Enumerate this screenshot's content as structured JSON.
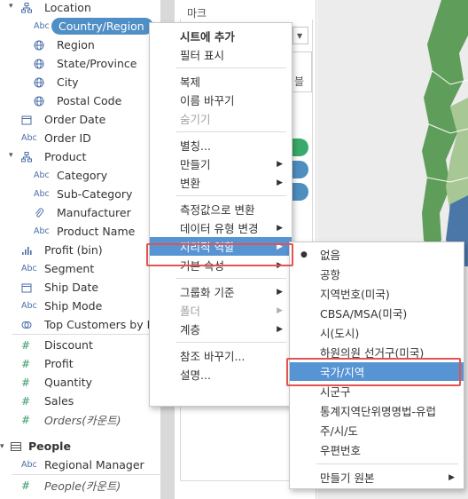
{
  "data_pane": {
    "fields": [
      {
        "icon": "hierarchy-icon",
        "label": "Location",
        "caret": true
      },
      {
        "icon": "abc-icon",
        "icon_text": "Abc",
        "label": "Country/Region",
        "selected": true
      },
      {
        "icon": "globe-icon",
        "label": "Region"
      },
      {
        "icon": "globe-icon",
        "label": "State/Province"
      },
      {
        "icon": "globe-icon",
        "label": "City"
      },
      {
        "icon": "globe-icon",
        "label": "Postal Code"
      },
      {
        "icon": "calendar-icon",
        "label": "Order Date"
      },
      {
        "icon": "abc-icon",
        "icon_text": "Abc",
        "label": "Order ID"
      },
      {
        "icon": "hierarchy-icon",
        "label": "Product",
        "caret": true
      },
      {
        "icon": "abc-icon",
        "icon_text": "Abc",
        "label": "Category"
      },
      {
        "icon": "abc-icon",
        "icon_text": "Abc",
        "label": "Sub-Category"
      },
      {
        "icon": "paperclip-icon",
        "label": "Manufacturer"
      },
      {
        "icon": "abc-icon",
        "icon_text": "Abc",
        "label": "Product Name"
      },
      {
        "icon": "bin-icon",
        "label": "Profit (bin)"
      },
      {
        "icon": "abc-icon",
        "icon_text": "Abc",
        "label": "Segment"
      },
      {
        "icon": "calendar-icon",
        "label": "Ship Date"
      },
      {
        "icon": "abc-icon",
        "icon_text": "Abc",
        "label": "Ship Mode"
      },
      {
        "icon": "set-icon",
        "label": "Top Customers by P..."
      }
    ],
    "measures": [
      {
        "icon": "hash-icon",
        "icon_text": "#",
        "label": "Discount"
      },
      {
        "icon": "hash-icon",
        "icon_text": "#",
        "label": "Profit"
      },
      {
        "icon": "hash-icon",
        "icon_text": "#",
        "label": "Quantity"
      },
      {
        "icon": "hash-icon",
        "icon_text": "#",
        "label": "Sales"
      },
      {
        "icon": "hash-icon",
        "icon_text": "#",
        "label": "Orders(카운트)",
        "italic": true
      }
    ],
    "people": {
      "title": "People",
      "fields": [
        {
          "icon": "abc-icon",
          "icon_text": "Abc",
          "label": "Regional Manager"
        },
        {
          "icon": "hash-icon",
          "icon_text": "#",
          "label": "People(카운트)",
          "italic": true
        }
      ]
    }
  },
  "marks": {
    "title": "마크",
    "label_fragment": "블",
    "pill_colors": [
      "#3aaa6a",
      "#4e8fbf",
      "#4e8fbf"
    ]
  },
  "map": {
    "colors": {
      "land": "#5f9e5a",
      "land_light": "#9dc08c",
      "water": "#e8e8e8",
      "blue": "#4b77a8"
    }
  },
  "context_menu": {
    "items": [
      {
        "label": "시트에 추가",
        "bold": true
      },
      {
        "label": "필터 표시"
      },
      {
        "sep": true
      },
      {
        "label": "복제"
      },
      {
        "label": "이름 바꾸기"
      },
      {
        "label": "숨기기",
        "disabled": true
      },
      {
        "sep": true
      },
      {
        "label": "별칭..."
      },
      {
        "label": "만들기",
        "submenu": true
      },
      {
        "label": "변환",
        "submenu": true
      },
      {
        "sep": true
      },
      {
        "label": "측정값으로 변환"
      },
      {
        "label": "데이터 유형 변경",
        "submenu": true
      },
      {
        "label": "지리적 역할",
        "submenu": true,
        "highlighted": true
      },
      {
        "label": "기본 속성",
        "submenu": true
      },
      {
        "sep": true
      },
      {
        "label": "그룹화 기준",
        "submenu": true
      },
      {
        "label": "폴더",
        "submenu": true,
        "disabled": true
      },
      {
        "label": "계층",
        "submenu": true
      },
      {
        "sep": true
      },
      {
        "label": "참조 바꾸기..."
      },
      {
        "label": "설명..."
      }
    ]
  },
  "geo_submenu": {
    "items": [
      {
        "label": "없음",
        "checked": true
      },
      {
        "label": "공항"
      },
      {
        "label": "지역번호(미국)"
      },
      {
        "label": "CBSA/MSA(미국)"
      },
      {
        "label": "시(도시)"
      },
      {
        "label": "하원의원 선거구(미국)"
      },
      {
        "label": "국가/지역",
        "highlighted": true
      },
      {
        "label": "시군구"
      },
      {
        "label": "통계지역단위명명법-유럽"
      },
      {
        "label": "주/시/도"
      },
      {
        "label": "우편번호"
      },
      {
        "sep": true
      },
      {
        "label": "만들기 원본",
        "submenu": true
      }
    ]
  }
}
